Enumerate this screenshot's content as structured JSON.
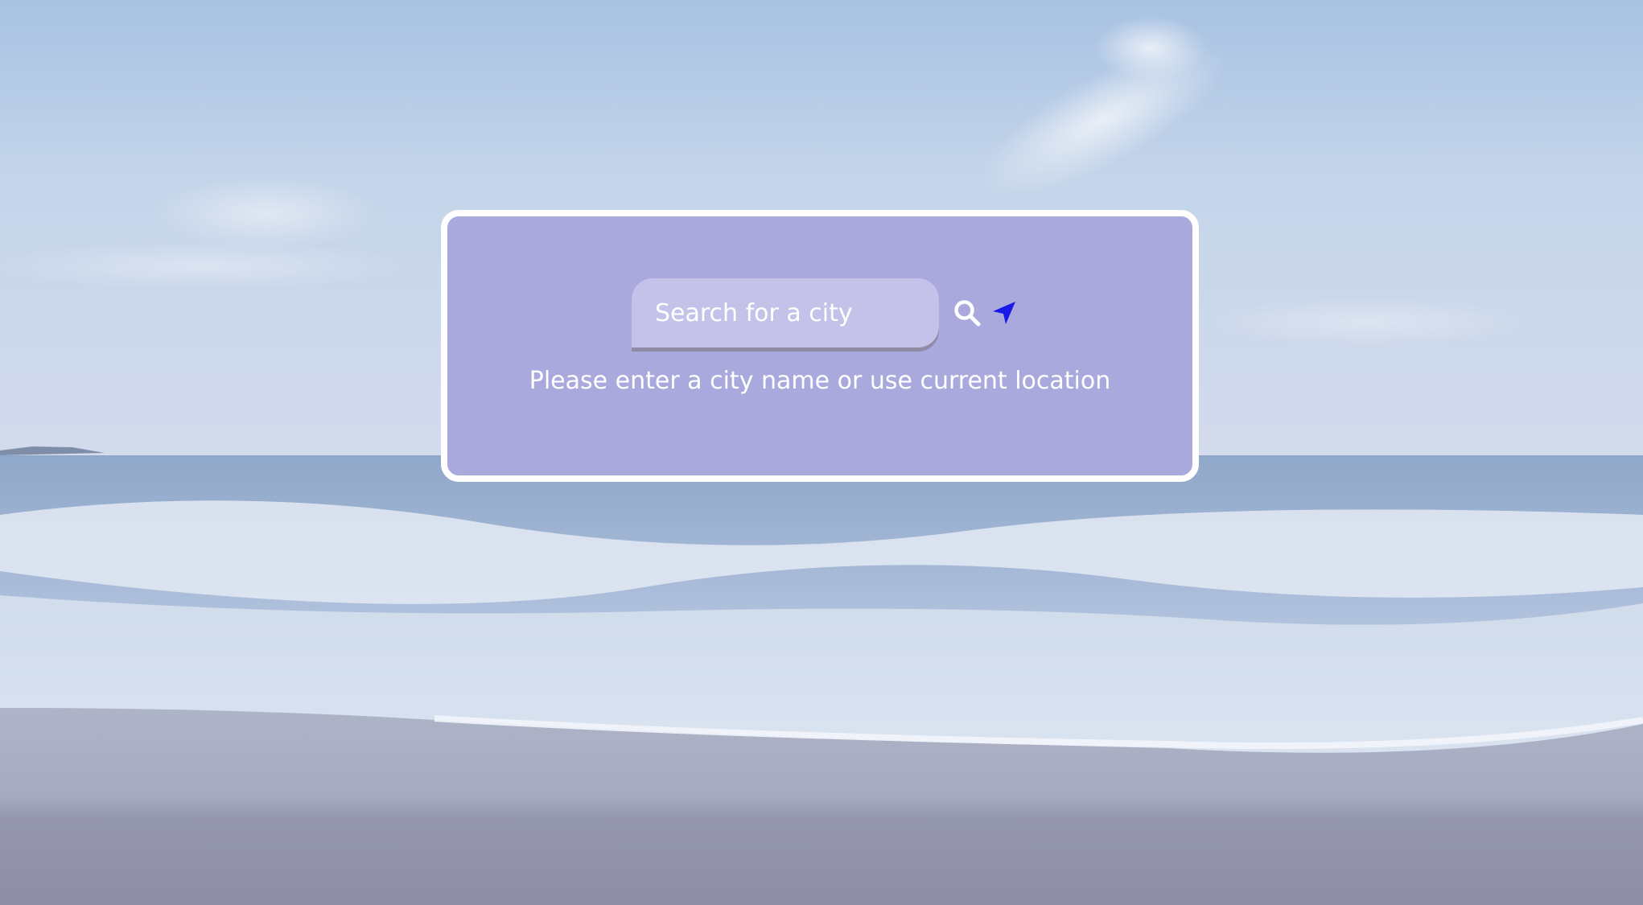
{
  "search": {
    "placeholder": "Search for a city",
    "value": ""
  },
  "hint_text": "Please enter a city name or use current location",
  "icons": {
    "search": "search-icon",
    "location": "location-arrow-icon"
  },
  "colors": {
    "card_bg": "#a9a9de",
    "card_border": "#ffffff",
    "input_bg": "#c4c2e8",
    "location_icon": "#1a1ae6",
    "text": "#ffffff"
  }
}
